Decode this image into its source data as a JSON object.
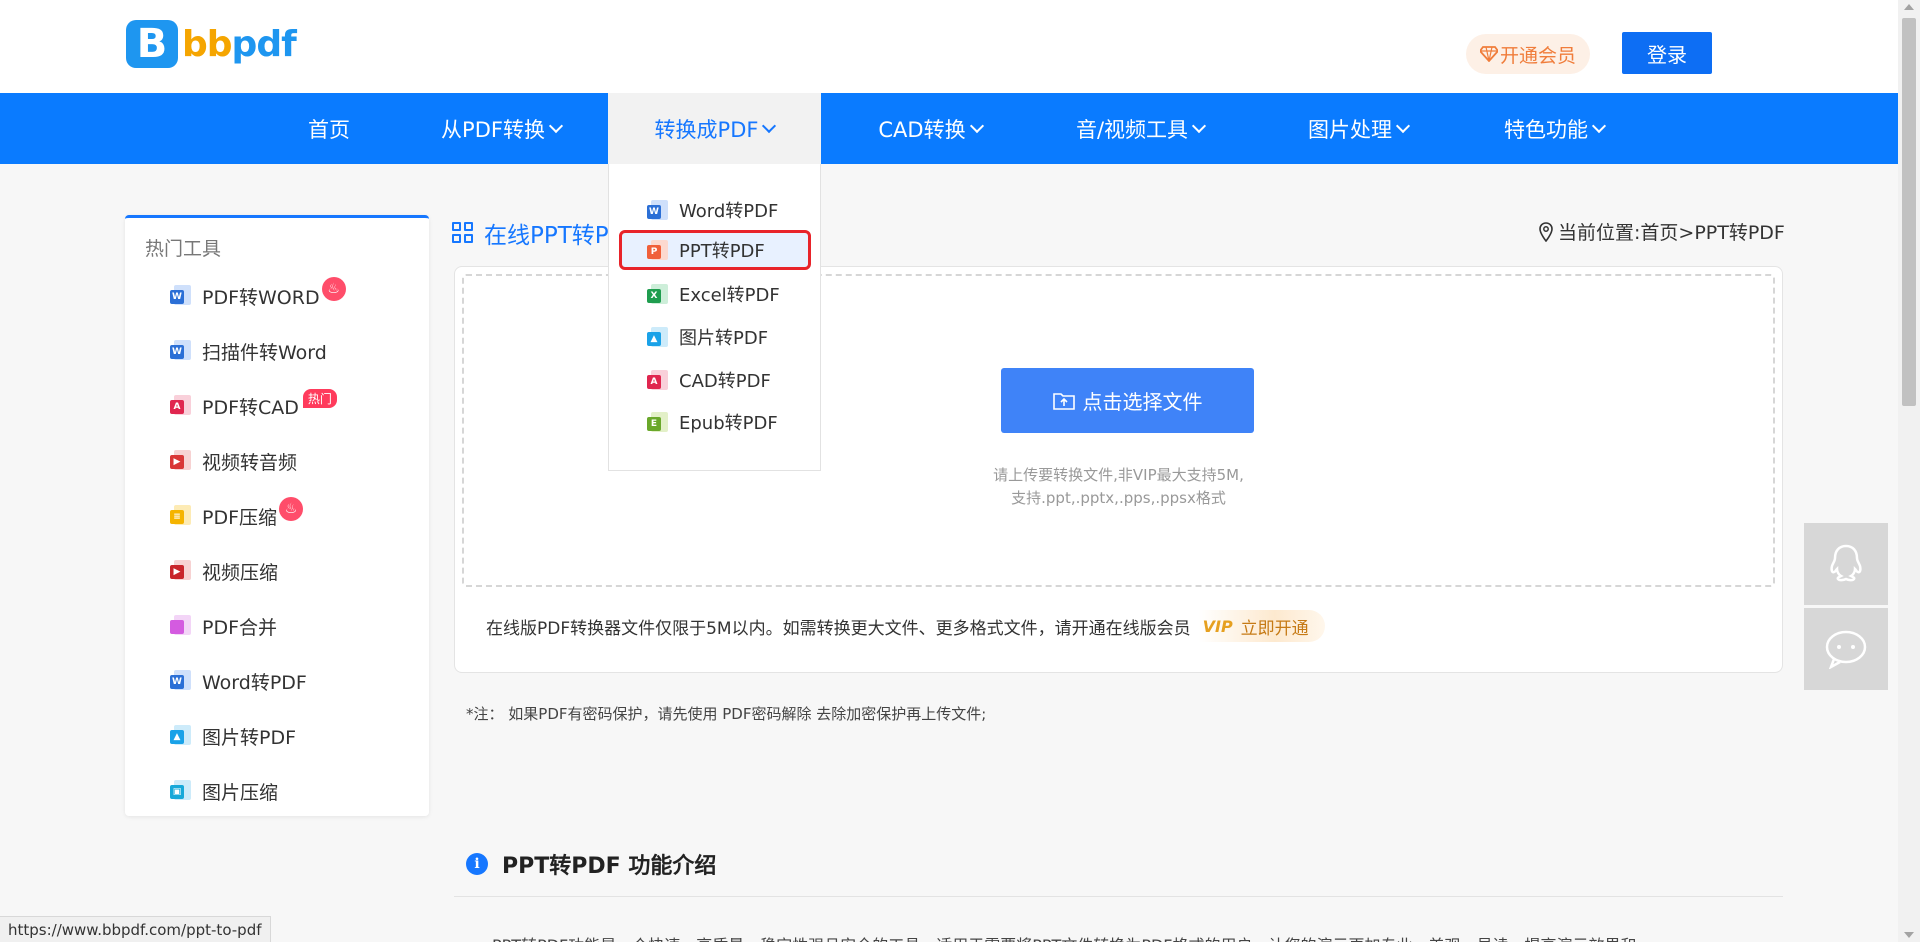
{
  "header": {
    "logo_letter": "B",
    "logo_bb": "bb",
    "logo_pdf": "pdf",
    "vip_label": "开通会员",
    "login_label": "登录"
  },
  "nav": {
    "items": [
      {
        "label": "首页"
      },
      {
        "label": "从PDF转换"
      },
      {
        "label": "转换成PDF"
      },
      {
        "label": "CAD转换"
      },
      {
        "label": "音/视频工具"
      },
      {
        "label": "图片处理"
      },
      {
        "label": "特色功能"
      }
    ]
  },
  "dropdown": {
    "items": [
      {
        "label": "Word转PDF",
        "icon": "word-icon",
        "color": "#2b6fd6"
      },
      {
        "label": "PPT转PDF",
        "icon": "ppt-icon",
        "color": "#f0603a",
        "selected": true
      },
      {
        "label": "Excel转PDF",
        "icon": "excel-icon",
        "color": "#1f9d4f"
      },
      {
        "label": "图片转PDF",
        "icon": "image-icon",
        "color": "#1aa2e8"
      },
      {
        "label": "CAD转PDF",
        "icon": "cad-icon",
        "color": "#e0264f"
      },
      {
        "label": "Epub转PDF",
        "icon": "epub-icon",
        "color": "#6aa82b"
      }
    ]
  },
  "sidebar": {
    "title": "热门工具",
    "hot_badge": "热门",
    "items": [
      {
        "label": "PDF转WORD",
        "icon": "pdf-to-word-icon",
        "badge": "fire"
      },
      {
        "label": "扫描件转Word",
        "icon": "scan-to-word-icon"
      },
      {
        "label": "PDF转CAD",
        "icon": "pdf-to-cad-icon",
        "badge": "hot"
      },
      {
        "label": "视频转音频",
        "icon": "video-to-audio-icon"
      },
      {
        "label": "PDF压缩",
        "icon": "pdf-compress-icon",
        "badge": "fire"
      },
      {
        "label": "视频压缩",
        "icon": "video-compress-icon"
      },
      {
        "label": "PDF合并",
        "icon": "pdf-merge-icon"
      },
      {
        "label": "Word转PDF",
        "icon": "word-to-pdf-icon"
      },
      {
        "label": "图片转PDF",
        "icon": "image-to-pdf-icon"
      },
      {
        "label": "图片压缩",
        "icon": "image-compress-icon"
      }
    ]
  },
  "main": {
    "title": "在线PPT转PDF",
    "location": "当前位置:首页>PPT转PDF",
    "select_button": "点击选择文件",
    "hint_line1": "请上传要转换文件,非VIP最大支持5M,",
    "hint_line2": "支持.ppt,.pptx,.pps,.ppsx格式",
    "notice": "在线版PDF转换器文件仅限于5M以内。如需转换更大文件、更多格式文件，请开通在线版会员",
    "vip_mark": "VIP",
    "open_now": "立即开通",
    "note": "*注：  如果PDF有密码保护，请先使用 PDF密码解除 去除加密保护再上传文件;",
    "section_title": "PPT转PDF 功能介绍",
    "section_text": "PPT转PDF功能是一个快速、高质量、稳定性强且安全的工具，适用于需要将PPT文件转换为PDF格式的用户，让您的演示更加专业、美观、易读，提高演示效果和"
  },
  "status_bar": {
    "url": "https://www.bbpdf.com/ppt-to-pdf"
  },
  "colors": {
    "nav_bg": "#0a7bff",
    "primary": "#1677ff",
    "select_button": "#3f83f8",
    "highlight_border": "#e8232a"
  }
}
